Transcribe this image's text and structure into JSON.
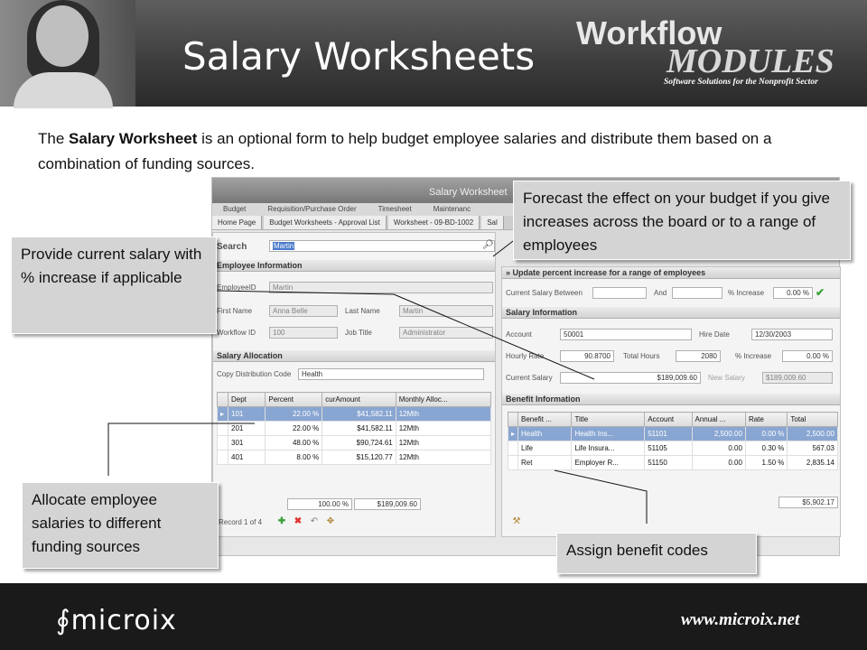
{
  "header": {
    "title": "Salary Worksheets",
    "logo_workflow": "Workflow",
    "logo_modules": "MODULES",
    "logo_tagline": "Software Solutions for the Nonprofit Sector"
  },
  "intro": {
    "prefix": "The ",
    "bold": "Salary Worksheet",
    "suffix": " is an optional form to help budget employee salaries and distribute them based on a combination of funding sources."
  },
  "callouts": {
    "forecast": "Forecast the effect on your budget if you give increases across the board or to a range of employees",
    "provide": "Provide current salary with % increase if applicable",
    "allocate": "Allocate employee salaries to different funding sources",
    "benefit": "Assign benefit codes"
  },
  "app": {
    "window_title": "Salary Worksheet",
    "menu": [
      "Budget",
      "Requisition/Purchase Order",
      "Timesheet",
      "Maintenanc"
    ],
    "tabs": [
      "Home Page",
      "Budget Worksheets - Approval List",
      "Worksheet - 09-BD-1002",
      "Sal"
    ],
    "search_label": "Search",
    "search_value": "Martin",
    "employee_section": "Employee Information",
    "employee": {
      "id_label": "EmployeeID",
      "id_value": "Martin",
      "first_label": "First Name",
      "first_value": "Anna Belle",
      "last_label": "Last Name",
      "last_value": "Martin",
      "workflow_label": "Workflow ID",
      "workflow_value": "100",
      "job_label": "Job Title",
      "job_value": "Administrator"
    },
    "allocation_section": "Salary Allocation",
    "copy_label": "Copy Distribution Code",
    "copy_value": "Health",
    "alloc_headers": [
      "Dept",
      "Percent",
      "curAmount",
      "Monthly Alloc..."
    ],
    "alloc_rows": [
      [
        "101",
        "22.00 %",
        "$41,582.11",
        "12Mth"
      ],
      [
        "201",
        "22.00 %",
        "$41,582.11",
        "12Mth"
      ],
      [
        "301",
        "48.00 %",
        "$90,724.61",
        "12Mth"
      ],
      [
        "401",
        "8.00 %",
        "$15,120.77",
        "12Mth"
      ]
    ],
    "alloc_total_percent": "100.00 %",
    "alloc_total_amount": "$189,009.60",
    "record_label": "Record 1 of 4",
    "range_section": "Update percent increase for a range of employees",
    "range": {
      "between_label": "Current Salary Between",
      "and_label": "And",
      "pct_label": "% Increase",
      "pct_value": "0.00 %"
    },
    "salary_section": "Salary Information",
    "salary": {
      "account_label": "Account",
      "account_value": "50001",
      "hire_label": "Hire Date",
      "hire_value": "12/30/2003",
      "rate_label": "Hourly Rate",
      "rate_value": "90.8700",
      "hours_label": "Total Hours",
      "hours_value": "2080",
      "inc_label": "% Increase",
      "inc_value": "0.00 %",
      "current_label": "Current Salary",
      "current_value": "$189,009.60",
      "new_label": "New Salary",
      "new_value": "$189,009.60"
    },
    "benefit_section": "Benefit Information",
    "benefit_headers": [
      "Benefit ...",
      "Title",
      "Account",
      "Annual ...",
      "Rate",
      "Total"
    ],
    "benefit_rows": [
      [
        "Health",
        "Health Ins...",
        "51101",
        "2,500.00",
        "0.00 %",
        "2,500.00"
      ],
      [
        "Life",
        "Life Insura...",
        "51105",
        "0.00",
        "0.30 %",
        "567.03"
      ],
      [
        "Ret",
        "Employer R...",
        "51150",
        "0.00",
        "1.50 %",
        "2,835.14"
      ]
    ],
    "benefit_total": "$5,902.17"
  },
  "footer": {
    "brand": "microix",
    "url": "www.microix.net"
  },
  "colors": {
    "header_bg": "#3c3c3c",
    "footer_bg": "#1a1a1a",
    "selection": "#7f9fcf"
  }
}
